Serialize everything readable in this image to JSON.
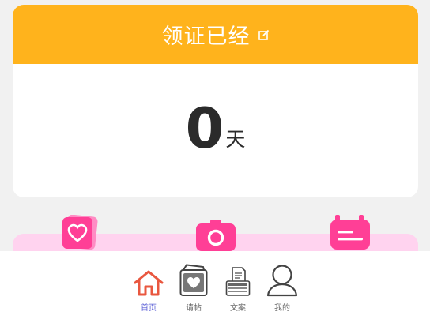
{
  "card": {
    "title": "领证已经",
    "days_value": "0",
    "days_unit": "天"
  },
  "features": [
    {
      "icon": "heart-card-icon"
    },
    {
      "icon": "camera-icon"
    },
    {
      "icon": "calendar-icon"
    }
  ],
  "nav": {
    "items": [
      {
        "label": "首页",
        "icon": "home-icon",
        "active": true
      },
      {
        "label": "请帖",
        "icon": "invitation-icon",
        "active": false
      },
      {
        "label": "文案",
        "icon": "document-icon",
        "active": false
      },
      {
        "label": "我的",
        "icon": "user-icon",
        "active": false
      }
    ]
  },
  "colors": {
    "header": "#ffb31c",
    "accent_pink": "#ff3f96",
    "active_nav": "#5b5fd6",
    "home_icon": "#e9573f"
  }
}
